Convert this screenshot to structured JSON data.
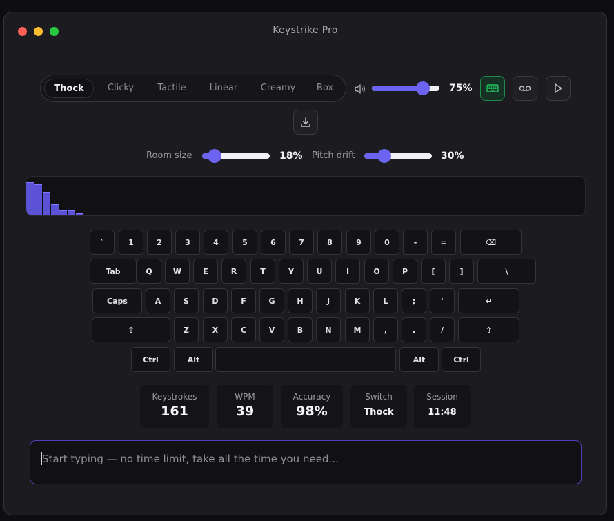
{
  "app": {
    "title": "Keystrike Pro"
  },
  "switches": {
    "items": [
      "Thock",
      "Clicky",
      "Tactile",
      "Linear",
      "Creamy",
      "Box"
    ],
    "selected": "Thock"
  },
  "volume": {
    "value_label": "75%",
    "value": 0.75,
    "icon": "speaker-icon"
  },
  "toolbar": {
    "keyboard_icon": "keyboard-icon",
    "record_icon": "voicemail-icon",
    "play_icon": "play-icon",
    "download_icon": "download-icon",
    "active_color": "#22c55e"
  },
  "room_size": {
    "label": "Room size",
    "value_label": "18%",
    "value": 0.18
  },
  "pitch_drift": {
    "label": "Pitch drift",
    "value_label": "30%",
    "value": 0.3
  },
  "visualizer": {
    "levels": [
      0.82,
      0.78,
      0.58,
      0.28,
      0.12,
      0.12,
      0.06
    ],
    "color": "#5b52d6"
  },
  "keyboard": {
    "rows": [
      [
        "`",
        "1",
        "2",
        "3",
        "4",
        "5",
        "6",
        "7",
        "8",
        "9",
        "0",
        "-",
        "=",
        "⌫"
      ],
      [
        "Tab",
        "Q",
        "W",
        "E",
        "R",
        "T",
        "Y",
        "U",
        "I",
        "O",
        "P",
        "[",
        "]",
        "\\"
      ],
      [
        "Caps",
        "A",
        "S",
        "D",
        "F",
        "G",
        "H",
        "J",
        "K",
        "L",
        ";",
        "'",
        "↵"
      ],
      [
        "⇧",
        "Z",
        "X",
        "C",
        "V",
        "B",
        "N",
        "M",
        ",",
        ".",
        "/",
        "⇧"
      ],
      [
        "Ctrl",
        "Alt",
        "",
        "Alt",
        "Ctrl"
      ]
    ]
  },
  "stats": [
    {
      "label": "Keystrokes",
      "value": "161"
    },
    {
      "label": "WPM",
      "value": "39"
    },
    {
      "label": "Accuracy",
      "value": "98%"
    },
    {
      "label": "Switch",
      "value": "Thock"
    },
    {
      "label": "Session",
      "value": "11:48"
    }
  ],
  "typing_area": {
    "placeholder": "Start typing — no time limit, take all the time you need..."
  },
  "accent": "#6c63f0"
}
